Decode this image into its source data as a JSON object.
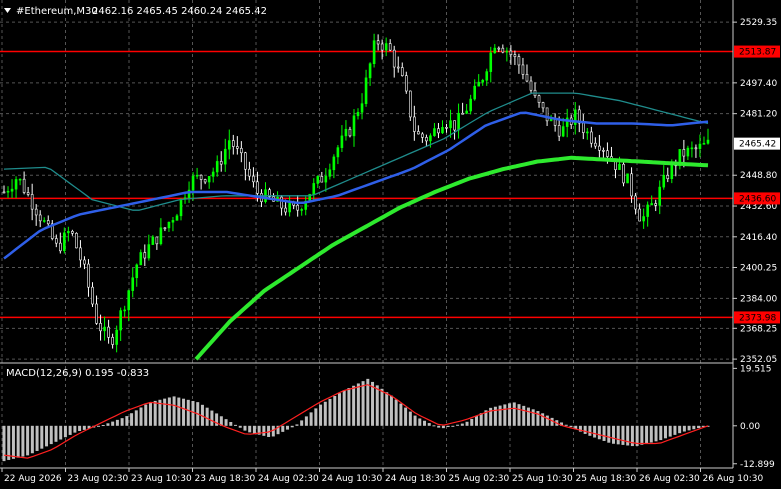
{
  "header": {
    "symbol": "#Ethereum,M30",
    "ohlc": "2462.16 2465.45 2460.24 2465.42"
  },
  "colors": {
    "background": "#000000",
    "grid": "#555555",
    "bull_candle": "#00ff00",
    "bear_candle": "#ffffff",
    "level_line": "#ff0000",
    "ma_fast": "#2f5fe8",
    "ma_slow": "#2eea2e",
    "ma_teal": "#1f8c8c",
    "macd_hist": "#c0c0c0",
    "macd_signal": "#ff2020",
    "current_price_bg": "#ffffff",
    "level_label_bg": "#ff0000"
  },
  "price_axis": {
    "ticks": [
      "2529.35",
      "2497.40",
      "2481.20",
      "2448.80",
      "2432.60",
      "2416.40",
      "2400.25",
      "2384.00",
      "2368.25",
      "2352.05"
    ],
    "current_price": "2465.42",
    "levels": [
      "2513.87",
      "2436.60",
      "2373.98"
    ]
  },
  "macd_panel": {
    "label": "MACD(12,26,9) 0.195 -0.833",
    "ticks": [
      "19.515",
      "0.00",
      "-12.899"
    ]
  },
  "time_axis": {
    "labels": [
      "22 Aug 2026",
      "23 Aug 02:30",
      "23 Aug 10:30",
      "23 Aug 18:30",
      "24 Aug 02:30",
      "24 Aug 10:30",
      "24 Aug 18:30",
      "25 Aug 02:30",
      "25 Aug 10:30",
      "25 Aug 18:30",
      "26 Aug 02:30",
      "26 Aug 10:30"
    ]
  },
  "chart_data": {
    "type": "candlestick",
    "symbol": "#Ethereum",
    "timeframe": "M30",
    "ylim": [
      2350,
      2541
    ],
    "levels": [
      2513.87,
      2436.6,
      2373.98
    ],
    "current_price": 2465.42,
    "price_anchors": [
      2440,
      2448,
      2436,
      2424,
      2410,
      2420,
      2400,
      2372,
      2360,
      2380,
      2402,
      2412,
      2420,
      2430,
      2446,
      2448,
      2452,
      2468,
      2455,
      2440,
      2436,
      2432,
      2430,
      2440,
      2448,
      2462,
      2472,
      2490,
      2520,
      2515,
      2498,
      2470,
      2468,
      2478,
      2475,
      2486,
      2500,
      2520,
      2514,
      2505,
      2488,
      2478,
      2472,
      2480,
      2470,
      2465,
      2455,
      2445,
      2425,
      2435,
      2450,
      2460,
      2462,
      2465
    ],
    "ma_fast_anchors": [
      2405,
      2420,
      2428,
      2432,
      2436,
      2440,
      2440,
      2437,
      2434,
      2438,
      2445,
      2452,
      2462,
      2475,
      2482,
      2478,
      2476,
      2476,
      2475,
      2477
    ],
    "ma_slow_anchors": [
      2352,
      2372,
      2388,
      2400,
      2412,
      2422,
      2432,
      2440,
      2447,
      2452,
      2456,
      2458,
      2457,
      2456,
      2455,
      2454
    ],
    "ma_teal_anchors": [
      2452,
      2453,
      2436,
      2430,
      2436,
      2438,
      2438,
      2438,
      2448,
      2458,
      2468,
      2482,
      2492,
      2492,
      2488,
      2482,
      2476
    ],
    "macd_ylim": [
      -14,
      21
    ],
    "macd_hist_anchors": [
      -12,
      -10,
      -6,
      -2,
      0,
      3,
      8,
      10,
      8,
      3,
      -2,
      -4,
      0,
      7,
      12,
      16,
      10,
      3,
      -1,
      1,
      6,
      8,
      5,
      1,
      -3,
      -6,
      -7,
      -5,
      -2,
      0
    ],
    "macd_signal_anchors": [
      -10,
      -11,
      -8,
      -3,
      1,
      5,
      8,
      7,
      4,
      0,
      -3,
      -2,
      3,
      8,
      12,
      14,
      10,
      4,
      0,
      2,
      5,
      6,
      4,
      0,
      -2,
      -4,
      -6,
      -6,
      -3,
      0
    ]
  }
}
